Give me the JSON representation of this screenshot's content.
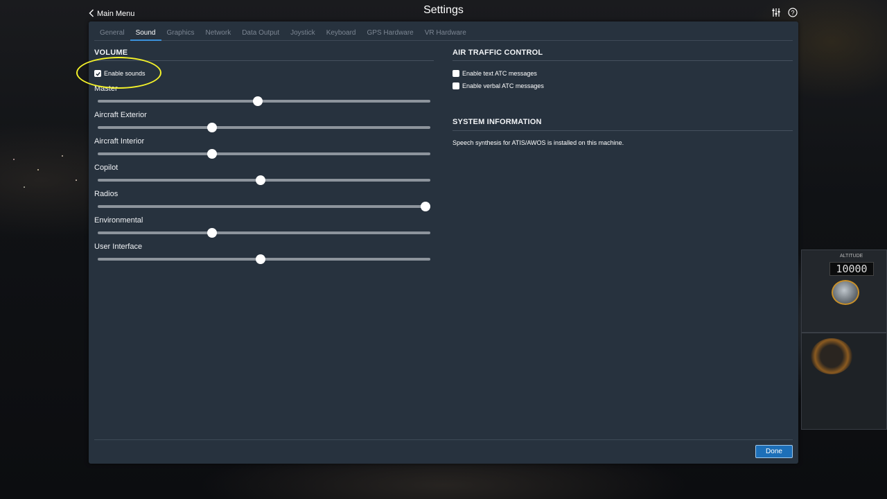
{
  "topbar": {
    "back_label": "Main Menu",
    "title": "Settings"
  },
  "tabs": [
    {
      "label": "General",
      "active": false
    },
    {
      "label": "Sound",
      "active": true
    },
    {
      "label": "Graphics",
      "active": false
    },
    {
      "label": "Network",
      "active": false
    },
    {
      "label": "Data Output",
      "active": false
    },
    {
      "label": "Joystick",
      "active": false
    },
    {
      "label": "Keyboard",
      "active": false
    },
    {
      "label": "GPS Hardware",
      "active": false
    },
    {
      "label": "VR Hardware",
      "active": false
    }
  ],
  "volume": {
    "title": "VOLUME",
    "enable_sounds": {
      "label": "Enable sounds",
      "checked": true
    },
    "sliders": [
      {
        "label": "Master",
        "value": 0.48
      },
      {
        "label": "Aircraft Exterior",
        "value": 0.34
      },
      {
        "label": "Aircraft Interior",
        "value": 0.34
      },
      {
        "label": "Copilot",
        "value": 0.49
      },
      {
        "label": "Radios",
        "value": 1.0
      },
      {
        "label": "Environmental",
        "value": 0.34
      },
      {
        "label": "User Interface",
        "value": 0.49
      }
    ]
  },
  "atc": {
    "title": "AIR TRAFFIC CONTROL",
    "options": [
      {
        "label": "Enable text ATC messages",
        "checked": false
      },
      {
        "label": "Enable verbal ATC messages",
        "checked": false
      }
    ]
  },
  "system_info": {
    "title": "SYSTEM INFORMATION",
    "text": "Speech synthesis for ATIS/AWOS is installed on this machine."
  },
  "footer": {
    "done_label": "Done"
  },
  "background": {
    "altitude_label": "ALTITUDE",
    "altitude_value": "10000"
  },
  "colors": {
    "accent": "#1d6fb8",
    "tab_underline": "#3a8fd8",
    "panel": "#27323e",
    "highlight": "#f4f22a"
  }
}
